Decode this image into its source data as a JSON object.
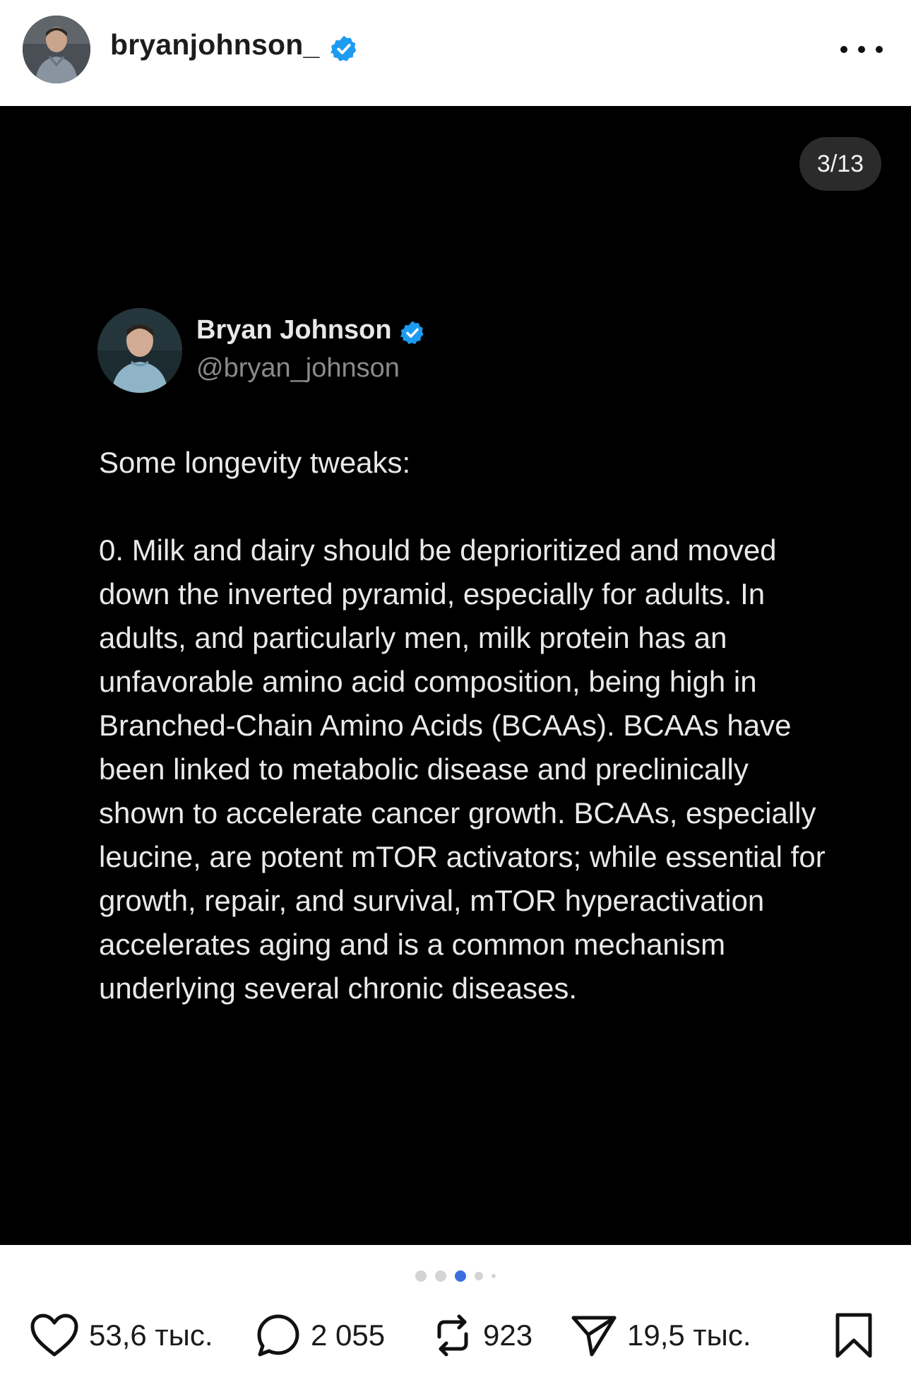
{
  "header": {
    "username": "bryanjohnson_",
    "verified": true,
    "more_icon": "more-horizontal-icon"
  },
  "media": {
    "counter": "3/13",
    "tweet": {
      "author_name": "Bryan Johnson",
      "author_handle": "@bryan_johnson",
      "verified": true,
      "intro": "Some longevity tweaks:",
      "body": "0. Milk and dairy should be deprioritized and moved down the inverted pyramid, especially for adults. In adults, and particularly men, milk protein has an unfavorable amino acid composition, being high in Branched-Chain Amino Acids (BCAAs). BCAAs have been linked to metabolic disease and preclinically shown to accelerate cancer growth. BCAAs, especially leucine, are potent mTOR activators; while essential for growth, repair, and survival, mTOR hyperactivation accelerates aging and is a common mechanism underlying several chronic diseases."
    }
  },
  "carousel": {
    "active_index": 2,
    "visible_dots": 5
  },
  "actions": {
    "likes": "53,6 тыс.",
    "comments": "2 055",
    "reposts": "923",
    "shares": "19,5 тыс."
  },
  "colors": {
    "verified_blue": "#1d9bf0",
    "active_dot": "#3b6fe0",
    "media_bg": "#000000"
  }
}
